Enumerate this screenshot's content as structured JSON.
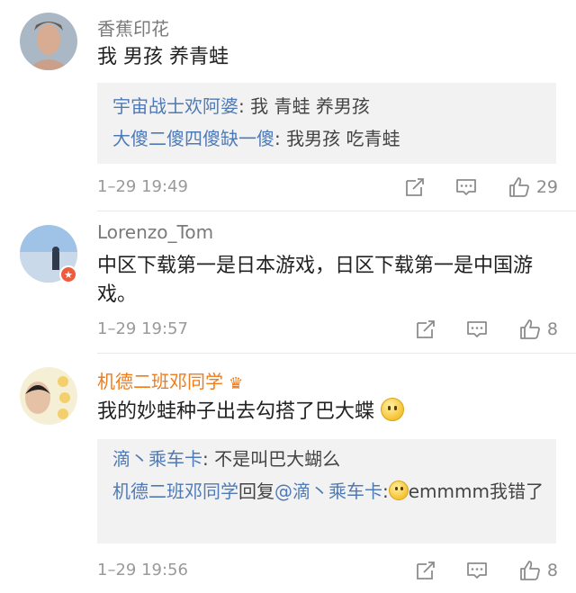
{
  "comments": [
    {
      "name": "香蕉印花",
      "text": "我 男孩 养青蛙",
      "replies": [
        {
          "who": "宇宙战士欢阿婆",
          "sep": ": ",
          "text": "我 青蛙 养男孩"
        },
        {
          "who": "大傻二傻四傻缺一傻",
          "sep": ": ",
          "text": "我男孩 吃青蛙"
        }
      ],
      "time": "1–29 19:49",
      "likes": "29"
    },
    {
      "name": "Lorenzo_Tom",
      "text": "中区下载第一是日本游戏，日区下载第一是中国游戏。",
      "time": "1–29 19:57",
      "likes": "8"
    },
    {
      "name": "机德二班邓同学",
      "text": "我的妙蛙种子出去勾搭了巴大蝶",
      "replies": [
        {
          "who": "滴丶乘车卡",
          "sep": ": ",
          "text": "不是叫巴大蝴么"
        },
        {
          "who": "机德二班邓同学",
          "mid": "回复",
          "who2": "@滴丶乘车卡",
          "sep": ":",
          "text": "emmmm我错了"
        }
      ],
      "time": "1–29 19:56",
      "likes": "8"
    }
  ],
  "colors": {
    "link": "#4f7ab5",
    "vip_name": "#ef7b1a",
    "meta": "#9a9a9a",
    "reply_bg": "#f2f2f2"
  },
  "icons": [
    "share-icon",
    "comment-icon",
    "like-icon",
    "crown-icon",
    "verified-badge-icon",
    "thinking-emoji-icon"
  ]
}
